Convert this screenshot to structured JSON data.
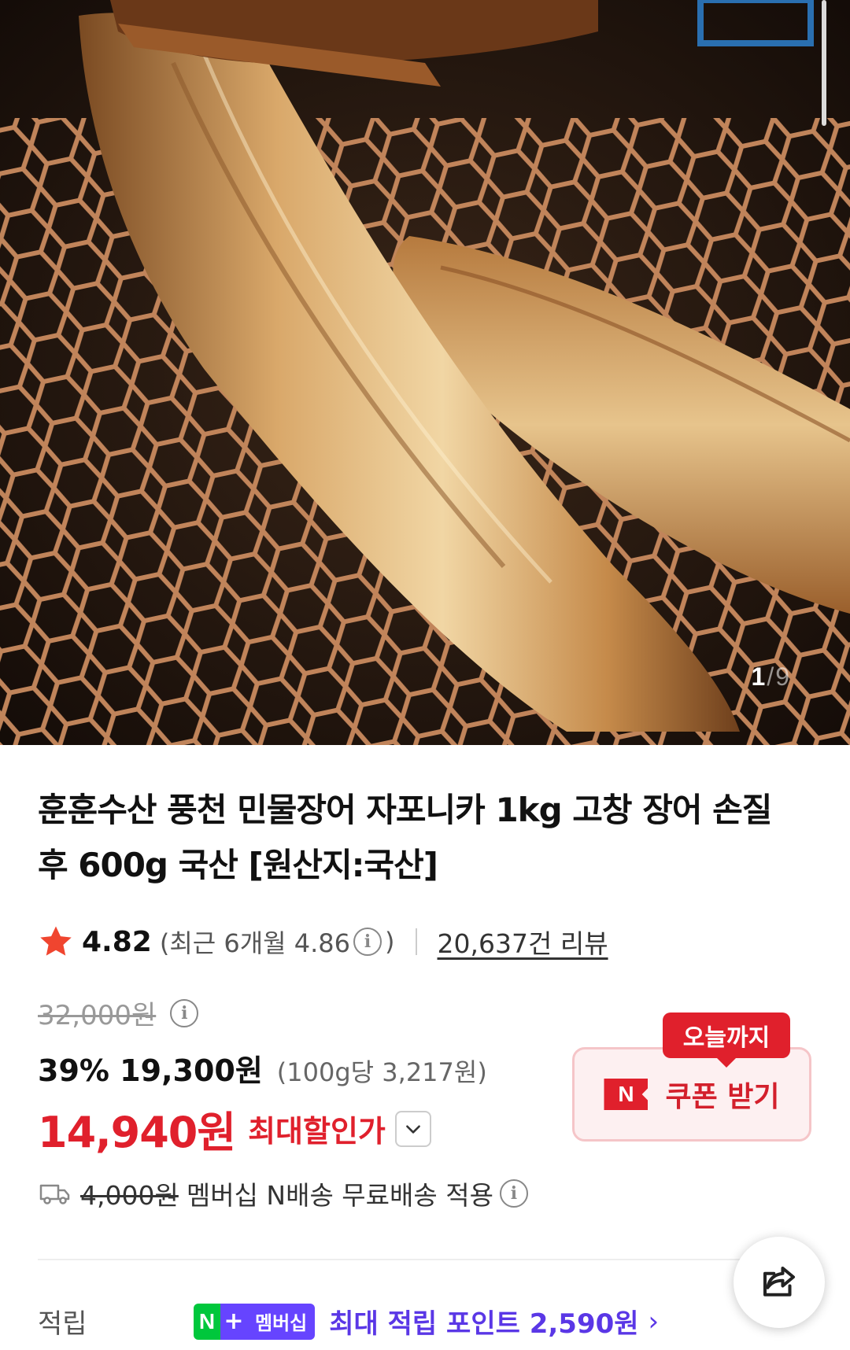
{
  "gallery": {
    "current": "1",
    "separator": "/",
    "total": "9"
  },
  "product": {
    "title_line1": "훈훈수산 풍천 민물장어 자포니카 1kg 고창 장어 손질",
    "title_line2": "후 600g 국산 [원산지:국산]"
  },
  "rating": {
    "score": "4.82",
    "recent_prefix": "(최근 6개월 4.86",
    "recent_suffix": ")",
    "info_glyph": "i",
    "reviews": "20,637건 리뷰"
  },
  "price": {
    "original": "32,000원",
    "discount_line": "39% 19,300원",
    "unit_price": "(100g당 3,217원)",
    "max_price": "14,940원",
    "max_label": "최대할인가"
  },
  "coupon": {
    "tag": "오늘까지",
    "logo": "N",
    "label": "쿠폰 받기"
  },
  "shipping": {
    "fee": "4,000원",
    "text": "멤버십 N배송 무료배송 적용"
  },
  "points": {
    "label": "적립",
    "badge_n": "N",
    "badge_plus": "+",
    "badge_member": "멤버십",
    "text": "최대 적립 포인트 2,590원",
    "arrow": "›"
  },
  "colors": {
    "accent_red": "#e0202c",
    "point_purple": "#5a37e6",
    "npay_green": "#00c73c"
  },
  "icons": [
    "star-icon",
    "info-icon",
    "chevron-down-icon",
    "truck-icon",
    "share-icon"
  ]
}
